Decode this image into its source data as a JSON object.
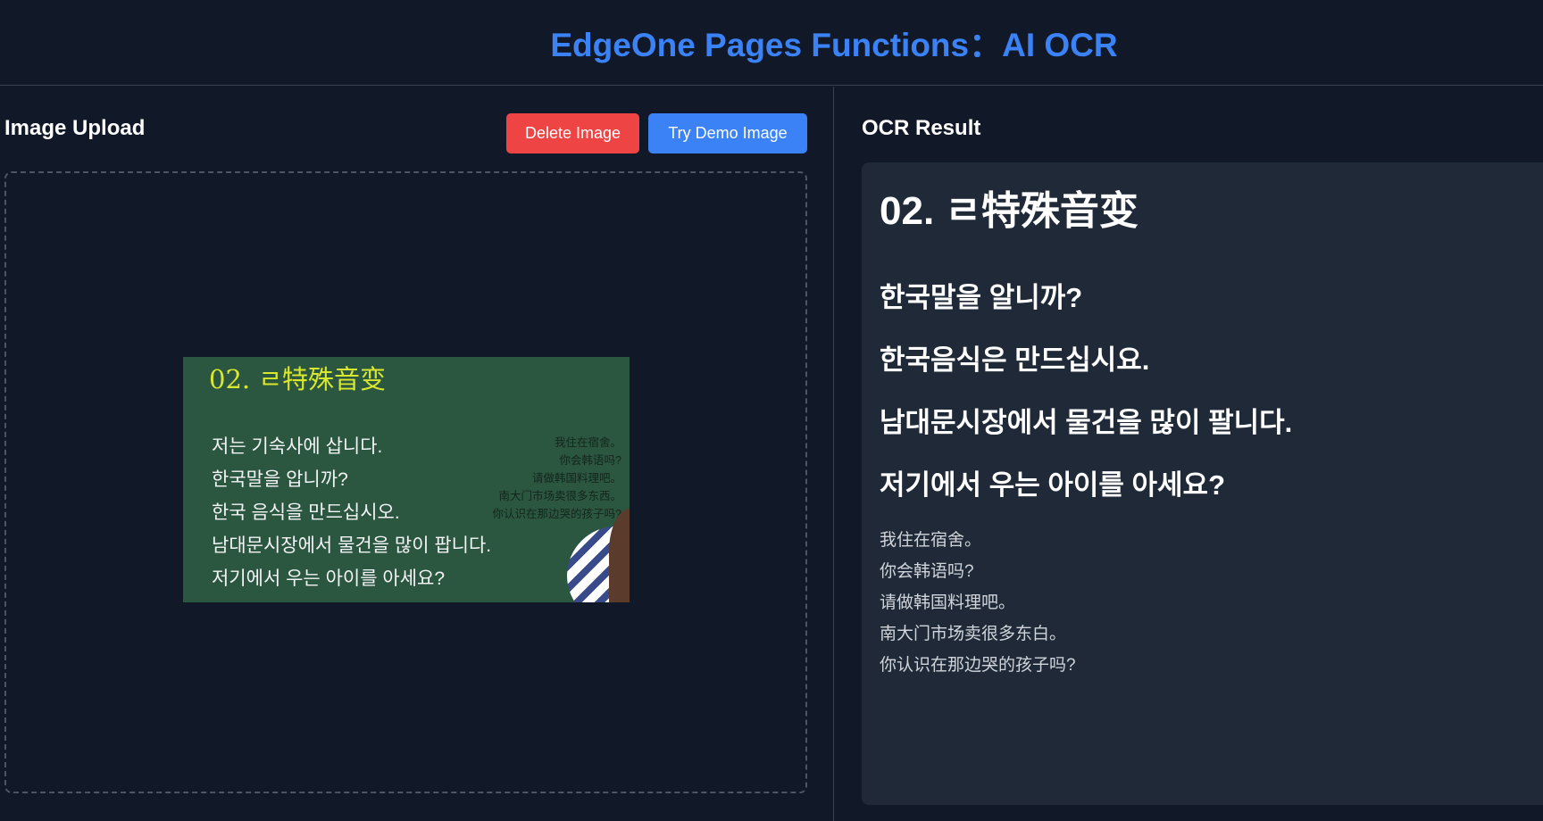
{
  "header": {
    "title": "EdgeOne Pages Functions：AI OCR"
  },
  "upload_panel": {
    "title": "Image Upload",
    "delete_label": "Delete Image",
    "demo_label": "Try Demo Image",
    "preview": {
      "title": "02.  ㄹ特殊音变",
      "korean_lines": [
        "저는 기숙사에 삽니다.",
        "한국말을 압니까?",
        "한국 음식을 만드십시오.",
        "남대문시장에서 물건을 많이 팝니다.",
        "저기에서 우는 아이를 아세요?"
      ],
      "chinese_lines": [
        "我住在宿舍。",
        "你会韩语吗?",
        "请做韩国料理吧。",
        "南大门市场卖很多东西。",
        "你认识在那边哭的孩子吗?"
      ]
    }
  },
  "result_panel": {
    "title": "OCR Result",
    "heading": "02. ㄹ特殊音变",
    "korean_lines": [
      "한국말을 알니까?",
      "한국음식은 만드십시요.",
      "남대문시장에서 물건을 많이 팔니다.",
      "저기에서 우는 아이를 아세요?"
    ],
    "chinese_lines": [
      "我住在宿舍。",
      "你会韩语吗?",
      "请做韩国料理吧。",
      "南大门市场卖很多东白。",
      "你认识在那边哭的孩子吗?"
    ]
  },
  "colors": {
    "background": "#111827",
    "accent": "#3b82f6",
    "danger": "#ef4444",
    "result_box": "#1f2937"
  }
}
